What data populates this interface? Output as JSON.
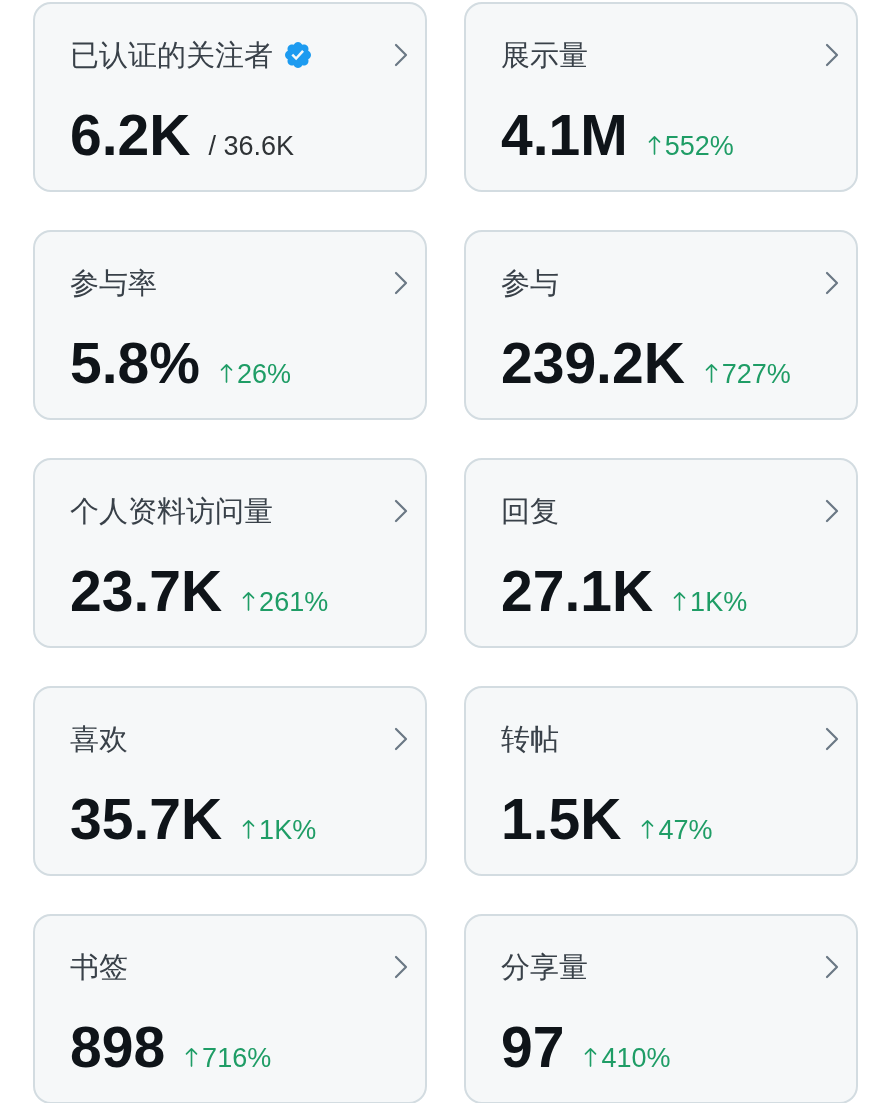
{
  "stats": [
    {
      "title": "已认证的关注者",
      "verified": true,
      "value": "6.2K",
      "total": "/ 36.6K"
    },
    {
      "title": "展示量",
      "verified": false,
      "value": "4.1M",
      "change": {
        "up": true,
        "text": "552%"
      }
    },
    {
      "title": "参与率",
      "verified": false,
      "value": "5.8%",
      "change": {
        "up": true,
        "text": "26%"
      }
    },
    {
      "title": "参与",
      "verified": false,
      "value": "239.2K",
      "change": {
        "up": true,
        "text": "727%"
      }
    },
    {
      "title": "个人资料访问量",
      "verified": false,
      "value": "23.7K",
      "change": {
        "up": true,
        "text": "261%"
      }
    },
    {
      "title": "回复",
      "verified": false,
      "value": "27.1K",
      "change": {
        "up": true,
        "text": "1K%"
      }
    },
    {
      "title": "喜欢",
      "verified": false,
      "value": "35.7K",
      "change": {
        "up": true,
        "text": "1K%"
      }
    },
    {
      "title": "转帖",
      "verified": false,
      "value": "1.5K",
      "change": {
        "up": true,
        "text": "47%"
      }
    },
    {
      "title": "书签",
      "verified": false,
      "value": "898",
      "change": {
        "up": true,
        "text": "716%"
      }
    },
    {
      "title": "分享量",
      "verified": false,
      "value": "97",
      "change": {
        "up": true,
        "text": "410%"
      }
    }
  ]
}
